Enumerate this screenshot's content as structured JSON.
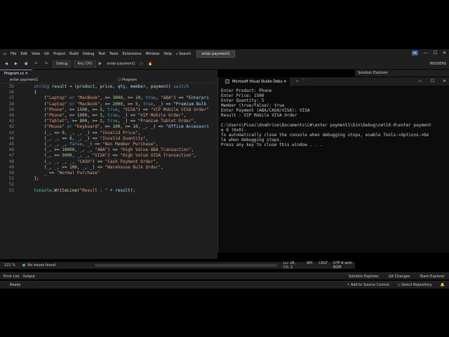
{
  "menu": {
    "items": [
      "File",
      "Edit",
      "View",
      "Git",
      "Project",
      "Build",
      "Debug",
      "Test",
      "Tools",
      "Extensions",
      "Window",
      "Help"
    ],
    "search_label": "Search",
    "solution_name": "enter payment1",
    "avatar": "AB"
  },
  "toolbar": {
    "config": "Debug",
    "platform": "Any CPU",
    "start_target": "enter payment1",
    "insiders": "INSIDERS"
  },
  "editor": {
    "tab": "Program.cs",
    "nav_left": "enter payment1",
    "nav_right": "Program",
    "lines": [
      {
        "n": "35",
        "t": "    string result = (product, price, qty, member, payment) switch"
      },
      {
        "n": "36",
        "t": "    {"
      },
      {
        "n": "37",
        "t": "        (\"Laptop\" or \"MacBook\", >= 3000, >= 10, true, \"ABA\") => \"Enterpri"
      },
      {
        "n": "38",
        "t": "        (\"Laptop\" or \"MacBook\", >= 2000, >= 5, true, _) => \"Premium Bulk"
      },
      {
        "n": "39",
        "t": "        (\"Phone\", >= 1500, >= 5, true, \"VISA\") => \"VIP Mobile VISA Order\""
      },
      {
        "n": "40",
        "t": "        (\"Phone\", >= 1000, >= 3, true, _) => \"VIP Mobile Order\","
      },
      {
        "n": "41",
        "t": "        (\"Tablet\", >= 800, >= 2, true, _) => \"Premium Tablet Order\","
      },
      {
        "n": "42",
        "t": "        (\"Mouse\" or \"Keyboard\", >= 100, >= 10, _, _) => \"Office Accessori"
      },
      {
        "n": "43",
        "t": "        (_, <= 0, _, _, _) => \"Invalid Price\","
      },
      {
        "n": "44",
        "t": "        (_, _, <= 0, _, _) => \"Invalid Quantity\","
      },
      {
        "n": "45",
        "t": "        (_, _, _, false, _) => \"Non Member Purchase\","
      },
      {
        "n": "46",
        "t": "        (_, >= 10000, _, _, \"ABA\") => \"High Value ABA Transaction\","
      },
      {
        "n": "47",
        "t": "        (_, >= 5000, _, _, \"VISA\") => \"High Value VISA Transaction\","
      },
      {
        "n": "48",
        "t": "        (_, _, _, _, \"CASH\") => \"Cash Payment Order\","
      },
      {
        "n": "49",
        "t": "        (_, _, >= 100, _, _) => \"Warehouse Bulk Order\","
      },
      {
        "n": "50",
        "t": "        _ => \"Normal Purchase\""
      },
      {
        "n": "51",
        "t": "    };"
      },
      {
        "n": "52",
        "t": ""
      },
      {
        "n": "53",
        "t": "    Console.WriteLine(\"Result : \" + result);"
      }
    ]
  },
  "console": {
    "title": "Microsoft Visual Studio Debu",
    "add": "+",
    "chevron": "˅",
    "window_controls": [
      "—",
      "☐",
      "✕"
    ],
    "lines": [
      "Enter Product: Phone",
      "Enter Price: 1500",
      "Enter Quantity: 5",
      "Member (true/false): true",
      "Enter Payment (ABA/CASH/VISA): VISA",
      "Result : VIP Mobile VISA Order",
      "",
      "C:\\Users\\Pisei\\OneDrive\\Documents\\C#\\enter payment1\\bin\\Debug\\net10.0\\enter payment",
      "e 0 (0x0).",
      "To automatically close the console when debugging stops, enable Tools->Options->De",
      "le when debugging stops.",
      "Press any key to close this window . . ."
    ]
  },
  "right_panel": {
    "title": "Solution Explorer"
  },
  "editor_status": {
    "zoom": "121 %",
    "issues": "No issues found",
    "position": "Ln: 28, Ch: 2",
    "spc": "SPC",
    "crlf": "CRLF",
    "encoding": "UTF-8 with BOM"
  },
  "bottom_tabs": {
    "left": [
      "Error List",
      "Output"
    ],
    "right": [
      "Solution Explorer",
      "Git Changes",
      "Team Explorer"
    ]
  },
  "status": {
    "ready": "Ready",
    "source_control": "Add to Source Control",
    "repository": "Select Repository"
  }
}
